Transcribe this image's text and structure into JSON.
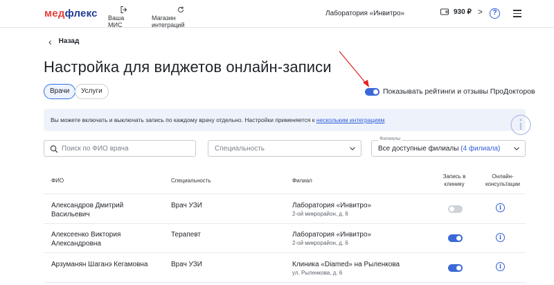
{
  "header": {
    "logo_pre": "мед",
    "logo_post": "флекс",
    "nav_mis": "Ваша МИС",
    "nav_store": "Магазин интеграций",
    "lab_name": "Лаборатория «Инвитро»",
    "balance": "930 ₽",
    "balance_chevron": ">",
    "help": "?"
  },
  "back_label": "Назад",
  "page_title": "Настройка для виджетов онлайн-записи",
  "tabs": [
    {
      "label": "Врачи",
      "active": true
    },
    {
      "label": "Услуги",
      "active": false
    }
  ],
  "ratings_toggle": {
    "label": "Показывать рейтинги и отзывы ПроДокторов",
    "on": true
  },
  "banner": {
    "text": "Вы можете включать и выключать запись по каждому врачу отдельно. Настройки применяется к ",
    "link": "нескольким интеграциям"
  },
  "filters": {
    "search_placeholder": "Поиск по ФИО врача",
    "specialty_placeholder": "Специальность",
    "branch_label": "Филиалы",
    "branch_value": "Все доступные филиалы",
    "branch_count": "(4 филиала)"
  },
  "table": {
    "headers": {
      "name": "ФИО",
      "specialty": "Специальность",
      "branch": "Филиал",
      "clinic_line1": "Запись в",
      "clinic_line2": "клинику",
      "online_line1": "Онлайн-",
      "online_line2": "консультации"
    },
    "rows": [
      {
        "name_line1": "Александров Дмитрий",
        "name_line2": "Васильевич",
        "specialty": "Врач УЗИ",
        "branch": "Лаборатория «Инвитро»",
        "address": "2-ой микрорайон, д. 6",
        "clinic_booking": false,
        "online_info": "i"
      },
      {
        "name_line1": "Алексеенко Виктория",
        "name_line2": "Александровна",
        "specialty": "Терапевт",
        "branch": "Лаборатория «Инвитро»",
        "address": "2-ой микрорайон, д. 6",
        "clinic_booking": true,
        "online_info": "i"
      },
      {
        "name_line1": "Арзуманян Шаганэ Кегамовна",
        "name_line2": "",
        "specialty": "Врач УЗИ",
        "branch": "Клиника «Diamed» на Рыленкова",
        "address": "ул. Рыленкова, д. 6",
        "clinic_booking": true,
        "online_info": "i"
      }
    ]
  },
  "colors": {
    "accent": "#2f5bd8",
    "brand_red": "#e8413c",
    "brand_blue": "#1f3a93",
    "banner_bg": "#eef3fb",
    "annotation": "#e02020"
  },
  "icons": [
    "exit-icon",
    "refresh-icon",
    "wallet-icon",
    "help-icon",
    "menu-icon",
    "back-arrow-icon",
    "search-icon",
    "chevron-down-icon",
    "info-icon"
  ]
}
